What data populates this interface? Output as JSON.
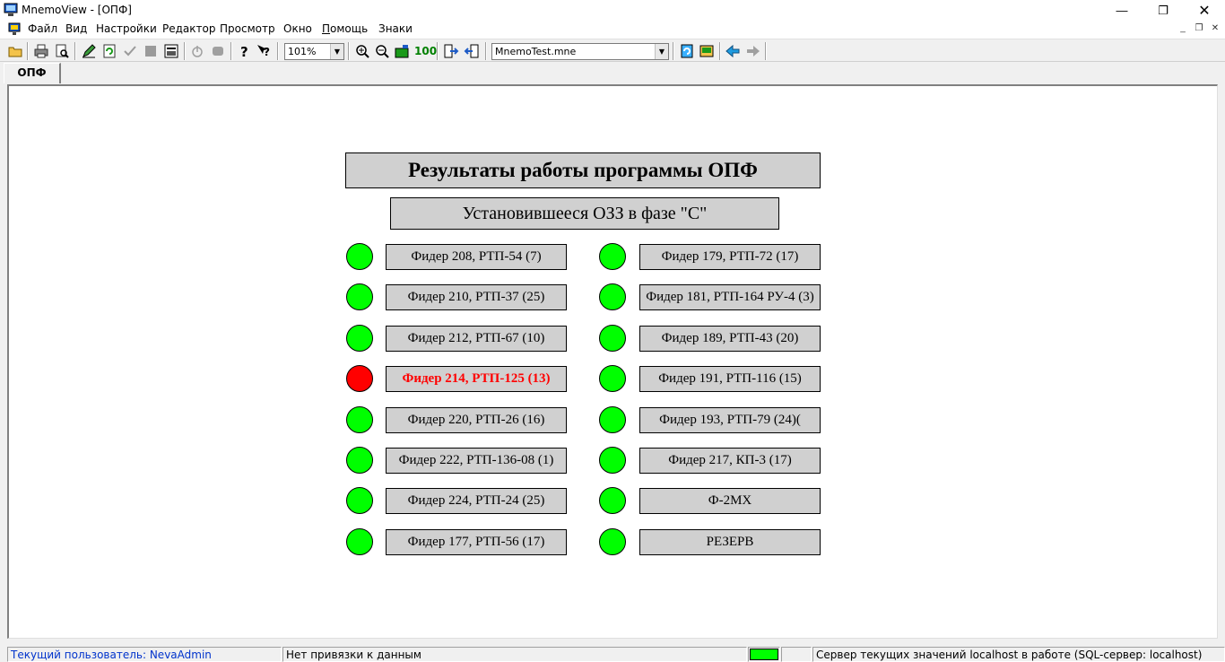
{
  "window": {
    "title": "MnemoView - [ОПФ]"
  },
  "menu": {
    "items": [
      "Файл",
      "Вид",
      "Настройки",
      "Редактор",
      "Просмотр",
      "Окно",
      "Помощь",
      "Знаки"
    ]
  },
  "toolbar": {
    "zoom_value": "101%",
    "file_value": "MnemoTest.mne",
    "icons": [
      "open-folder-icon",
      "print-icon",
      "print-preview-icon",
      "edit-pencil-icon",
      "refresh-icon",
      "check-icon",
      "stop-square-icon",
      "window-icon",
      "power-icon",
      "cylinder-icon",
      "help-icon",
      "context-help-icon",
      "zoom-in-icon",
      "zoom-out-icon",
      "zoom-fit-icon",
      "zoom-100-icon",
      "import-icon",
      "export-icon",
      "reload-icon",
      "image-icon",
      "back-arrow-icon",
      "forward-arrow-icon"
    ],
    "zoom100_label": "100"
  },
  "tabs": [
    {
      "label": "ОПФ"
    }
  ],
  "mnemo": {
    "title": "Результаты работы программы ОПФ",
    "subtitle": "Установившееся ОЗЗ в фазе \"С\"",
    "colors": {
      "ok": "#00ff00",
      "alarm": "#ff0000",
      "panel": "#d0d0d0"
    },
    "left_feeders": [
      {
        "label": "Фидер 208, РТП-54 (7)",
        "status": "ok"
      },
      {
        "label": "Фидер 210, РТП-37 (25)",
        "status": "ok"
      },
      {
        "label": "Фидер 212, РТП-67 (10)",
        "status": "ok"
      },
      {
        "label": "Фидер 214, РТП-125 (13)",
        "status": "alarm"
      },
      {
        "label": "Фидер 220, РТП-26 (16)",
        "status": "ok"
      },
      {
        "label": "Фидер 222, РТП-136-08 (1)",
        "status": "ok"
      },
      {
        "label": "Фидер 224, РТП-24 (25)",
        "status": "ok"
      },
      {
        "label": "Фидер 177, РТП-56 (17)",
        "status": "ok"
      }
    ],
    "right_feeders": [
      {
        "label": "Фидер 179, РТП-72 (17)",
        "status": "ok"
      },
      {
        "label": "Фидер 181, РТП-164 РУ-4 (3)",
        "status": "ok"
      },
      {
        "label": "Фидер 189, РТП-43 (20)",
        "status": "ok"
      },
      {
        "label": "Фидер 191, РТП-116 (15)",
        "status": "ok"
      },
      {
        "label": "Фидер 193, РТП-79 (24)(",
        "status": "ok"
      },
      {
        "label": "Фидер 217, КП-3 (17)",
        "status": "ok"
      },
      {
        "label": "Ф-2МХ",
        "status": "ok"
      },
      {
        "label": "РЕЗЕРВ",
        "status": "ok"
      }
    ]
  },
  "status": {
    "user": "Текущий пользователь: NevaAdmin",
    "binding": "Нет привязки к данным",
    "indicator_color": "#00ff00",
    "server": "Сервер текущих значений localhost в работе  (SQL-сервер: localhost)"
  }
}
